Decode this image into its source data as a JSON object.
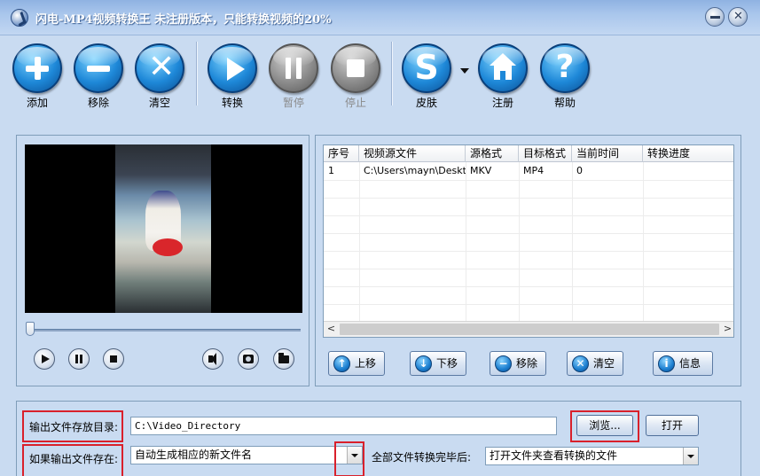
{
  "window": {
    "title": "闪电-MP4视频转换王  未注册版本，只能转换视频的20%"
  },
  "toolbar": {
    "add": "添加",
    "remove": "移除",
    "clear": "清空",
    "convert": "转换",
    "pause": "暂停",
    "stop": "停止",
    "skin": "皮肤",
    "register": "注册",
    "help": "帮助"
  },
  "file_list": {
    "columns": [
      "序号",
      "视频源文件",
      "源格式",
      "目标格式",
      "当前时间",
      "转换进度"
    ],
    "rows": [
      {
        "index": "1",
        "source": "C:\\Users\\mayn\\Deskt...",
        "src_format": "MKV",
        "target_format": "MP4",
        "current_time": "0",
        "progress": ""
      }
    ]
  },
  "list_buttons": {
    "up": "上移",
    "down": "下移",
    "remove": "移除",
    "clear": "清空",
    "info": "信息"
  },
  "settings": {
    "output_dir_label": "输出文件存放目录:",
    "output_dir_value": "C:\\Video_Directory",
    "browse": "浏览...",
    "open": "打开",
    "if_exists_label": "如果输出文件存在:",
    "if_exists_value": "自动生成相应的新文件名",
    "after_all_label": "全部文件转换完毕后:",
    "after_all_value": "打开文件夹查看转换的文件"
  },
  "media_controls": {
    "seek_fraction": 0.0
  }
}
